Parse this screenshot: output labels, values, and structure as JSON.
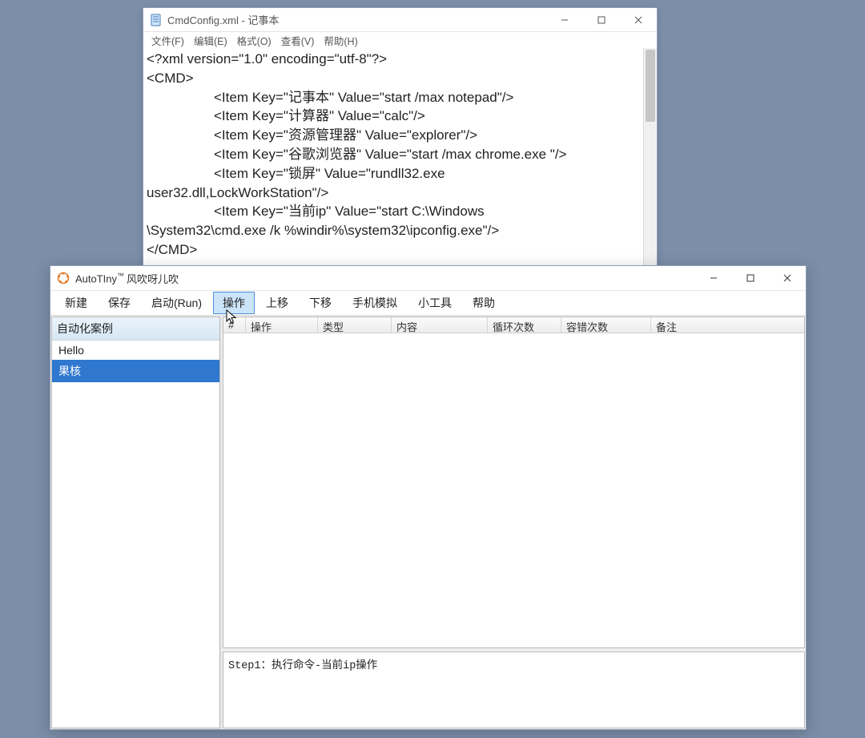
{
  "notepad": {
    "title": "CmdConfig.xml - 记事本",
    "menu": {
      "file": "文件(F)",
      "edit": "编辑(E)",
      "format": "格式(O)",
      "view": "查看(V)",
      "help": "帮助(H)"
    },
    "lines": [
      "<?xml version=\"1.0\" encoding=\"utf-8\"?>",
      "<CMD>",
      "<Item Key=\"记事本\" Value=\"start /max notepad\"/>",
      "<Item Key=\"计算器\" Value=\"calc\"/>",
      "<Item Key=\"资源管理器\" Value=\"explorer\"/>",
      "<Item Key=\"谷歌浏览器\" Value=\"start /max chrome.exe \"/>",
      "<Item Key=\"锁屏\" Value=\"rundll32.exe",
      "user32.dll,LockWorkStation\"/>",
      "<Item Key=\"当前ip\" Value=\"start C:\\Windows",
      "\\System32\\cmd.exe /k %windir%\\system32\\ipconfig.exe\"/>",
      "</CMD>"
    ],
    "indent_for_line": [
      false,
      false,
      true,
      true,
      true,
      true,
      true,
      false,
      true,
      false,
      false
    ]
  },
  "autotiny": {
    "title_main": "AutoTIny",
    "title_tm": "™",
    "title_sub": " 风吹呀儿吹",
    "toolbar": {
      "new": "新建",
      "save": "保存",
      "run": "启动(Run)",
      "op": "操作",
      "up": "上移",
      "down": "下移",
      "phone": "手机模拟",
      "tools": "小工具",
      "help": "帮助"
    },
    "sidebar": {
      "header": "自动化案例",
      "items": [
        "Hello",
        "果核"
      ],
      "selected_index": 1
    },
    "table": {
      "headers": {
        "idx": "#",
        "op": "操作",
        "type": "类型",
        "content": "内容",
        "loop": "循环次数",
        "tolerance": "容错次数",
        "note": "备注"
      }
    },
    "status": "Step1：执行命令-当前ip操作"
  }
}
